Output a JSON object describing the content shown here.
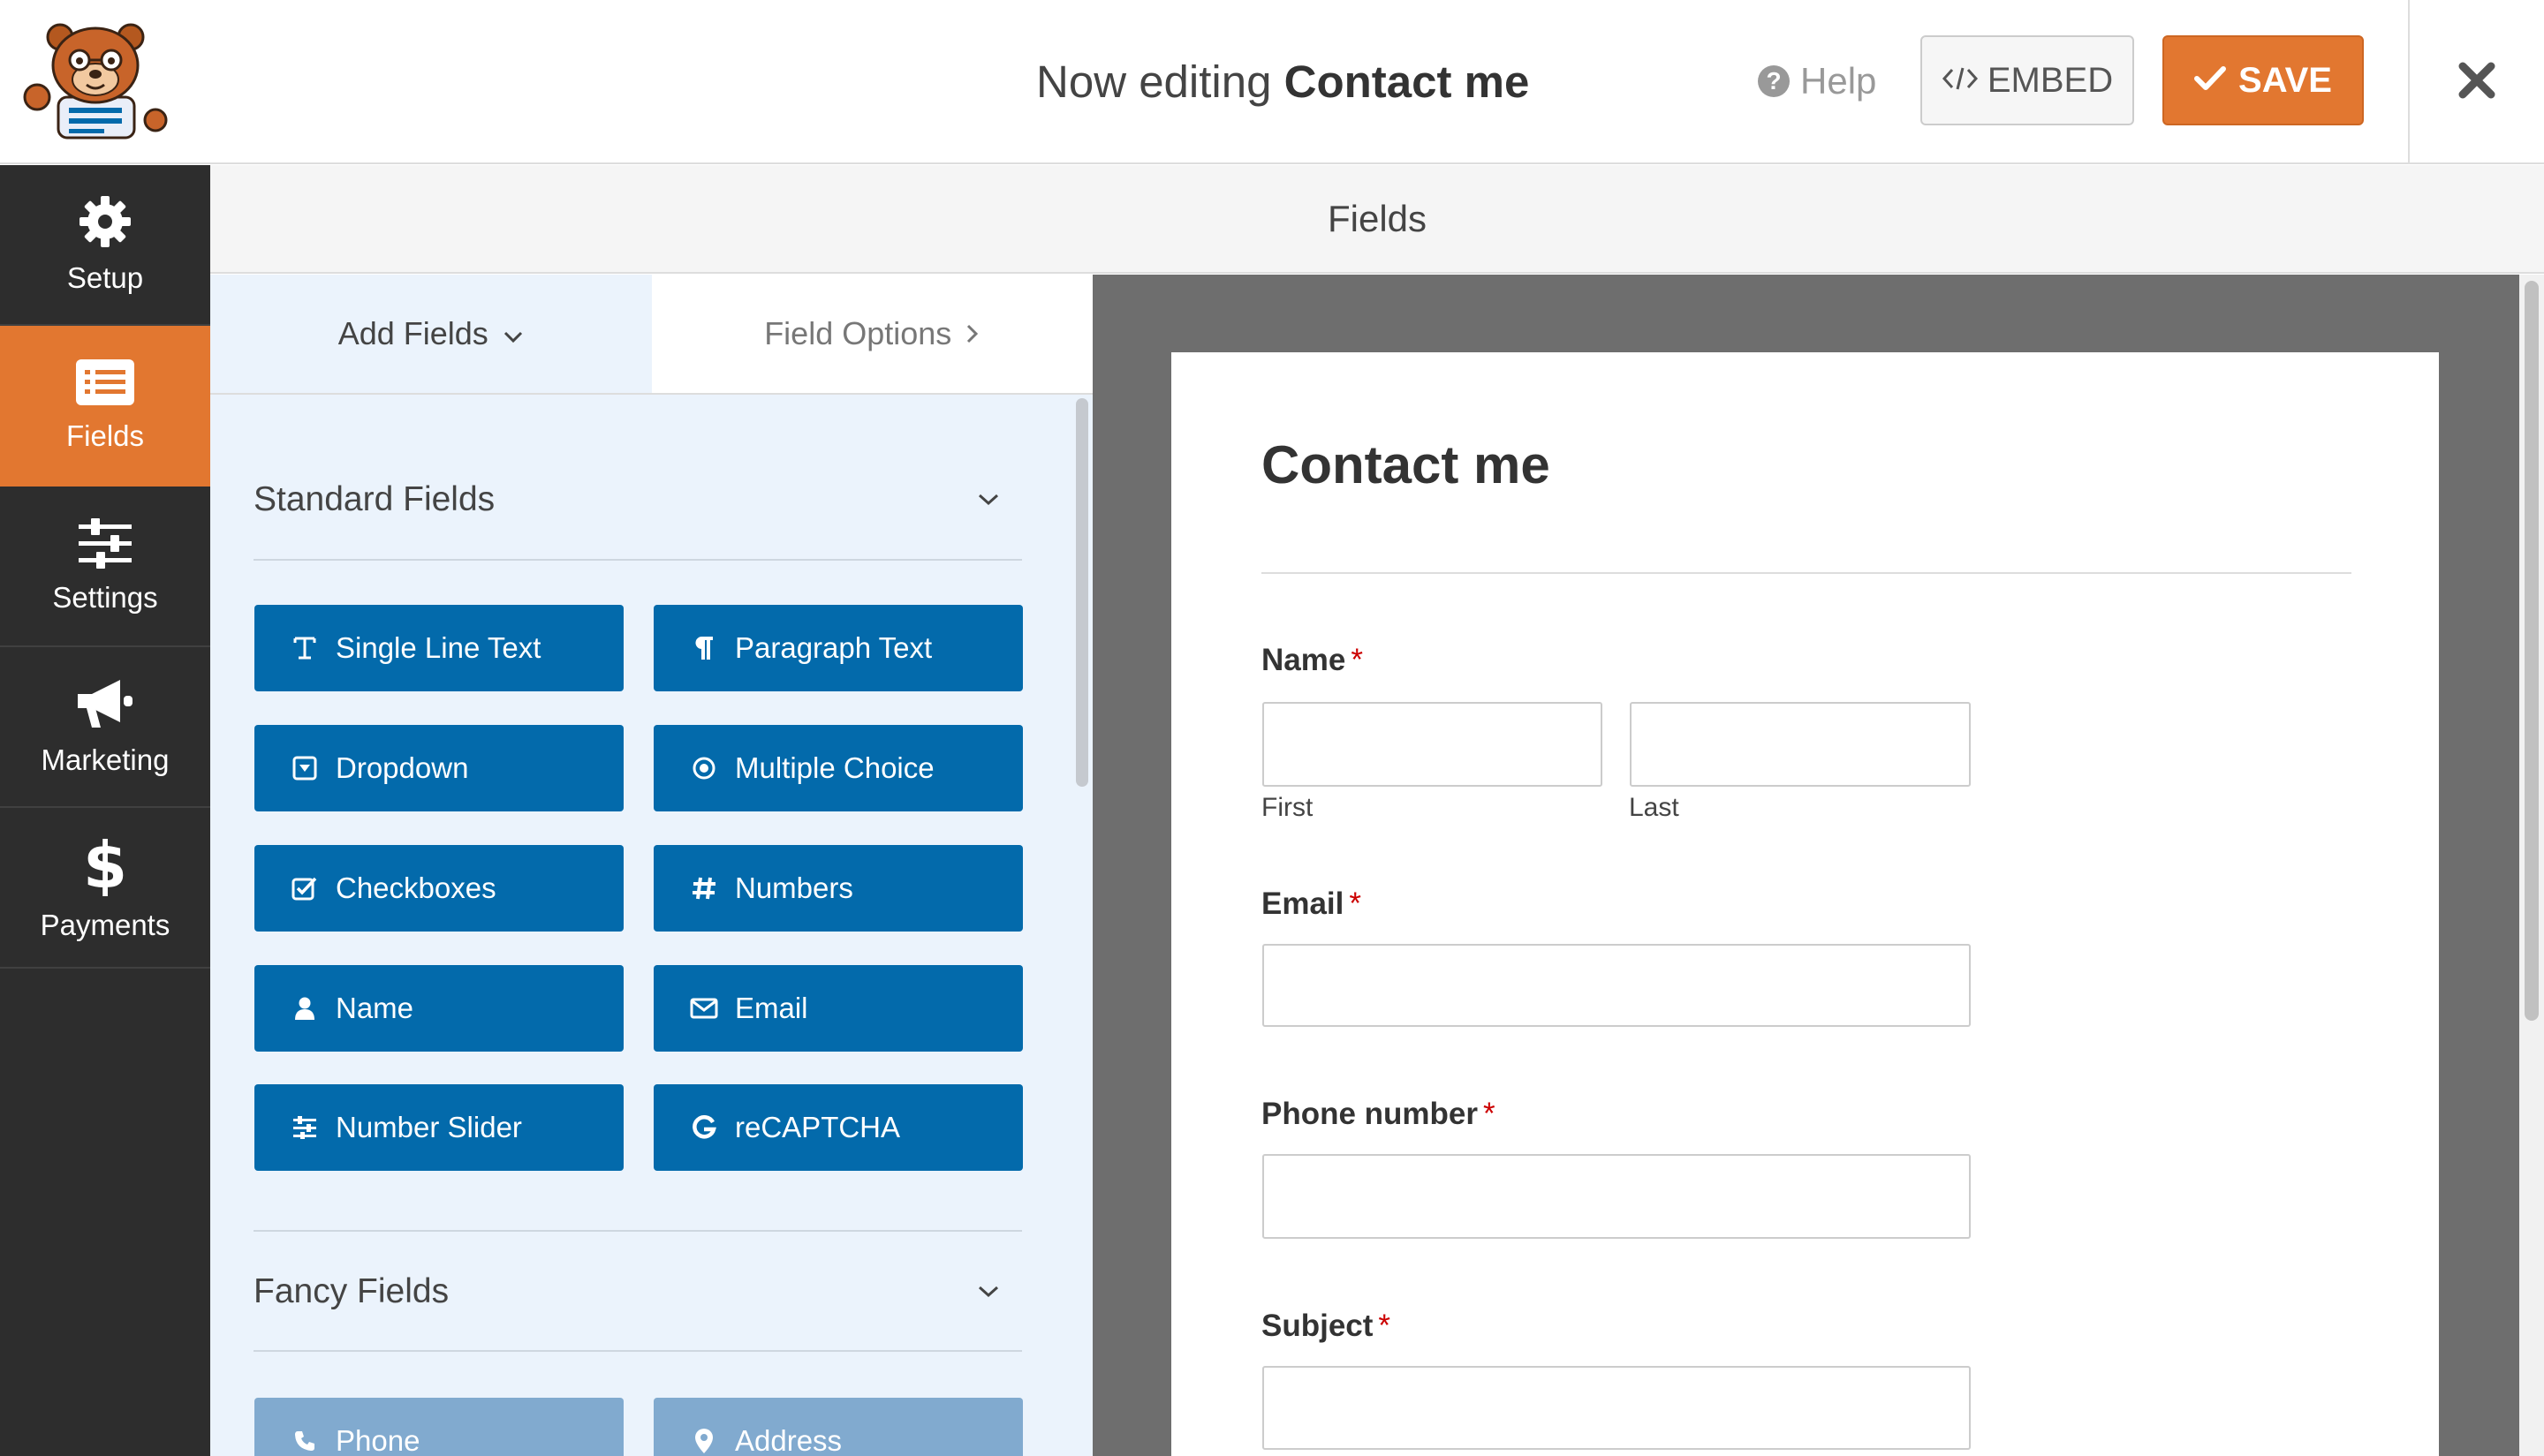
{
  "header": {
    "title_prefix": "Now editing",
    "form_name": "Contact me",
    "help_label": "Help",
    "embed_label": "EMBED",
    "save_label": "SAVE"
  },
  "sidebar": {
    "items": [
      {
        "label": "Setup",
        "icon": "gear-icon",
        "active": false
      },
      {
        "label": "Fields",
        "icon": "fields-list-icon",
        "active": true
      },
      {
        "label": "Settings",
        "icon": "sliders-icon",
        "active": false
      },
      {
        "label": "Marketing",
        "icon": "megaphone-icon",
        "active": false
      },
      {
        "label": "Payments",
        "icon": "dollar-icon",
        "active": false
      }
    ]
  },
  "section_header": "Fields",
  "panel": {
    "tabs": {
      "add": "Add Fields",
      "options": "Field Options"
    },
    "standard_group": "Standard Fields",
    "standard_fields": [
      {
        "label": "Single Line Text",
        "icon": "text-cursor-icon"
      },
      {
        "label": "Paragraph Text",
        "icon": "paragraph-icon"
      },
      {
        "label": "Dropdown",
        "icon": "dropdown-icon"
      },
      {
        "label": "Multiple Choice",
        "icon": "radio-icon"
      },
      {
        "label": "Checkboxes",
        "icon": "checkbox-icon"
      },
      {
        "label": "Numbers",
        "icon": "hash-icon"
      },
      {
        "label": "Name",
        "icon": "user-icon"
      },
      {
        "label": "Email",
        "icon": "envelope-icon"
      },
      {
        "label": "Number Slider",
        "icon": "sliders-icon"
      },
      {
        "label": "reCAPTCHA",
        "icon": "google-g-icon"
      }
    ],
    "fancy_group": "Fancy Fields",
    "fancy_fields": [
      {
        "label": "Phone",
        "icon": "phone-icon"
      },
      {
        "label": "Address",
        "icon": "map-pin-icon"
      }
    ]
  },
  "form": {
    "title": "Contact me",
    "fields": {
      "name": {
        "label": "Name",
        "required": "*",
        "first": "First",
        "last": "Last"
      },
      "email": {
        "label": "Email",
        "required": "*"
      },
      "phone": {
        "label": "Phone number",
        "required": "*"
      },
      "subject": {
        "label": "Subject",
        "required": "*"
      }
    }
  },
  "colors": {
    "accent_orange": "#e27730",
    "field_button_blue": "#036aab",
    "sidebar_dark": "#2d2d2d",
    "panel_bg": "#ebf3fc"
  }
}
